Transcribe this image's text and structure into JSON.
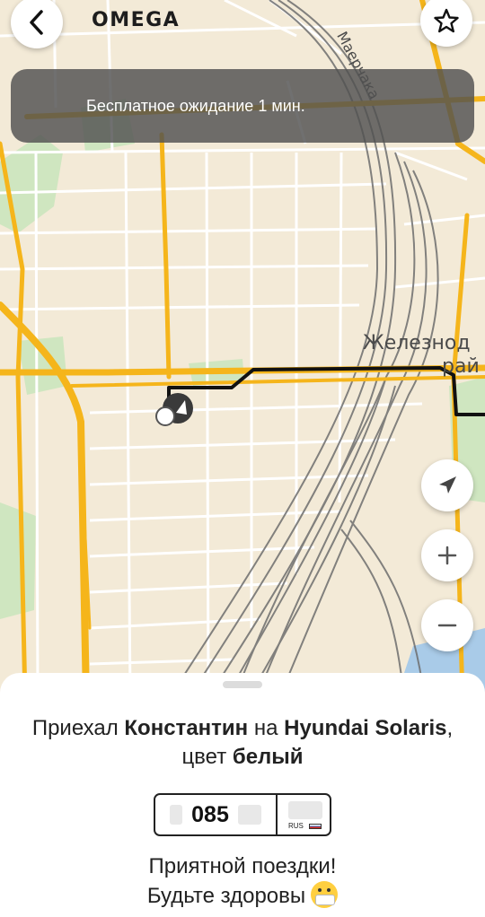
{
  "header": {
    "back_icon": "chevron-left-icon",
    "logo": "OMEGA",
    "favorite_icon": "star-icon"
  },
  "banner": {
    "text": "Бесплатное ожидание 1 мин."
  },
  "map": {
    "labels": {
      "street": "Маерчака",
      "district_line1": "Железнод",
      "district_line2": "рай"
    },
    "colors": {
      "background": "#f3ead7",
      "main_road": "#f5b51b",
      "park": "#cfe6c0",
      "railway": "#6e6e6e",
      "route": "#111111"
    },
    "controls": {
      "locate_icon": "navigation-arrow-icon",
      "zoom_in_icon": "plus-icon",
      "zoom_out_icon": "minus-icon"
    }
  },
  "sheet": {
    "arrival": {
      "prefix": "Приехал ",
      "driver": "Константин",
      "middle": " на ",
      "car": "Hyundai Solaris",
      "color_label": ", цвет ",
      "color_value": "белый"
    },
    "plate": {
      "number": "085",
      "country": "RUS"
    },
    "wish_line1": "Приятной поездки!",
    "wish_line2": "Будьте здоровы",
    "emoji": "face-with-medical-mask-emoji"
  }
}
